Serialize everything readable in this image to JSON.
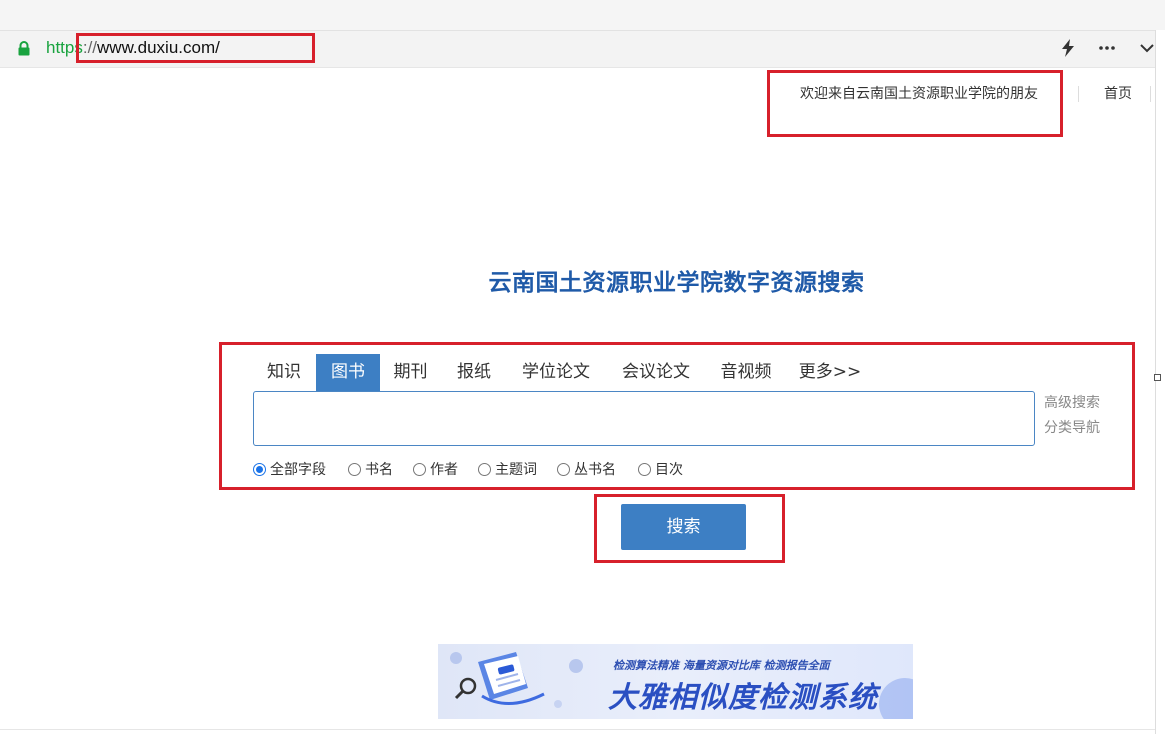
{
  "browser": {
    "url_scheme": "https",
    "url_separator": "://",
    "url_host": "www.duxiu.com/",
    "icons": [
      "lock-icon",
      "lightning-icon",
      "more-icon",
      "chevron-down-icon"
    ]
  },
  "header": {
    "welcome": "欢迎来自云南国土资源职业学院的朋友",
    "home_link": "首页"
  },
  "site_title": "云南国土资源职业学院数字资源搜索",
  "tabs": [
    {
      "label": "知识",
      "active": false
    },
    {
      "label": "图书",
      "active": true
    },
    {
      "label": "期刊",
      "active": false
    },
    {
      "label": "报纸",
      "active": false
    },
    {
      "label": "学位论文",
      "active": false
    },
    {
      "label": "会议论文",
      "active": false
    },
    {
      "label": "音视频",
      "active": false
    },
    {
      "label": "更多>>",
      "active": false
    }
  ],
  "search": {
    "value": "",
    "advanced_link": "高级搜索",
    "category_link": "分类导航",
    "button_label": "搜索"
  },
  "fields": [
    {
      "label": "全部字段",
      "checked": true
    },
    {
      "label": "书名",
      "checked": false
    },
    {
      "label": "作者",
      "checked": false
    },
    {
      "label": "主题词",
      "checked": false
    },
    {
      "label": "丛书名",
      "checked": false
    },
    {
      "label": "目次",
      "checked": false
    }
  ],
  "banner": {
    "slogan": "检测算法精准 海量资源对比库 检测报告全面",
    "title": "大雅相似度检测系统"
  },
  "colors": {
    "accent": "#3d7fc4",
    "title": "#1f5aa8",
    "highlight_box": "#d7202b",
    "url_scheme": "#19a33f"
  }
}
